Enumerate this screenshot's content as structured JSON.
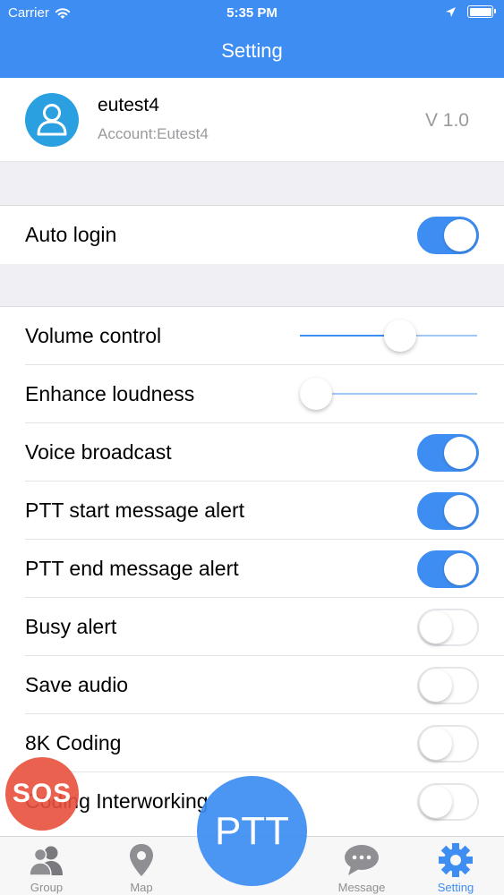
{
  "status_bar": {
    "carrier": "Carrier",
    "time": "5:35 PM",
    "battery_level": 100
  },
  "nav": {
    "title": "Setting"
  },
  "profile": {
    "name": "eutest4",
    "account": "Account:Eutest4",
    "version": "V 1.0"
  },
  "auto_login": {
    "label": "Auto login",
    "on": true
  },
  "settings": {
    "volume": {
      "label": "Volume control",
      "value": 0.58
    },
    "loudness": {
      "label": "Enhance loudness",
      "value": 0.0
    },
    "voice_broadcast": {
      "label": "Voice broadcast",
      "on": true
    },
    "ptt_start_alert": {
      "label": "PTT start message alert",
      "on": true
    },
    "ptt_end_alert": {
      "label": "PTT end message alert",
      "on": true
    },
    "busy_alert": {
      "label": "Busy alert",
      "on": false
    },
    "save_audio": {
      "label": "Save audio",
      "on": false
    },
    "coding_8k": {
      "label": "8K Coding",
      "on": false
    },
    "coding_interworking": {
      "label": "Coding Interworking",
      "on": false
    }
  },
  "floating": {
    "sos": "SOS",
    "ptt": "PTT"
  },
  "tabs": {
    "group": "Group",
    "map": "Map",
    "message": "Message",
    "setting": "Setting"
  },
  "colors": {
    "accent": "#3d8df2",
    "sos": "#e8503c",
    "avatar": "#2aa0e0"
  }
}
